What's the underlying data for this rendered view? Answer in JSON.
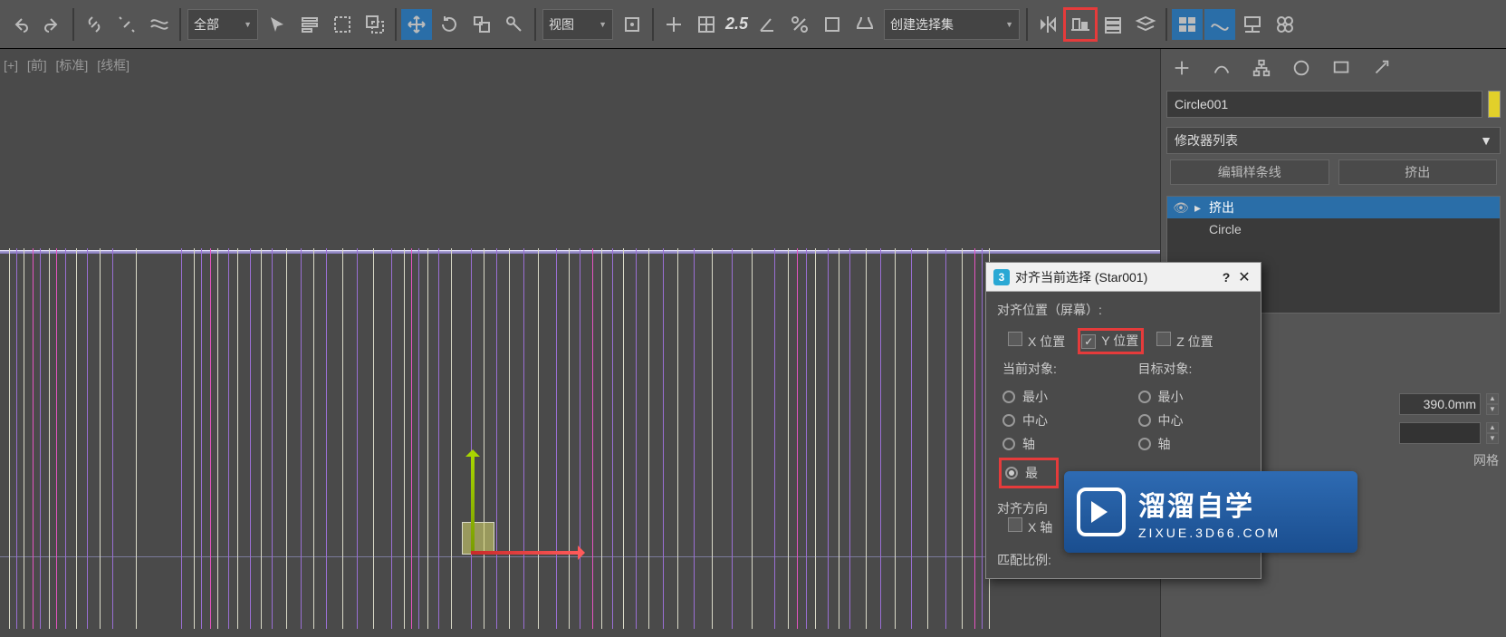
{
  "toolbar": {
    "filter_all": "全部",
    "view_drop": "视图",
    "selset_drop": "创建选择集",
    "two_five": "2.5"
  },
  "viewport": {
    "plus": "[+]",
    "view": "[前]",
    "shade": "[标准]",
    "mode": "[线框]"
  },
  "panel": {
    "object_name": "Circle001",
    "modifier_list": "修改器列表",
    "btn_editspline": "编辑样条线",
    "btn_extrude": "挤出",
    "stack": {
      "extrude": "挤出",
      "circle": "Circle"
    },
    "param_value": "390.0mm",
    "footer_grid": "网格"
  },
  "dialog": {
    "title": "对齐当前选择 (Star001)",
    "help": "?",
    "section_pos": "对齐位置（屏幕）:",
    "x_pos": "X 位置",
    "y_pos": "Y 位置",
    "z_pos": "Z 位置",
    "current_obj": "当前对象:",
    "target_obj": "目标对象:",
    "opt_min": "最小",
    "opt_center": "中心",
    "opt_pivot_partial": "轴",
    "opt_max_partial": "最",
    "section_orient": "对齐方向",
    "x_axis_partial": "X 轴",
    "section_scale": "匹配比例:"
  },
  "watermark": {
    "big": "溜溜自学",
    "small": "ZIXUE.3D66.COM"
  }
}
